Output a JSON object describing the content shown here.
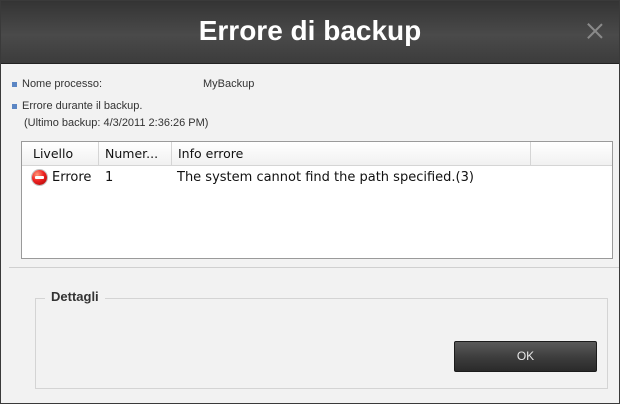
{
  "dialog": {
    "title": "Errore di backup",
    "process_label": "Nome processo:",
    "process_value": "MyBackup",
    "error_line1": "Errore durante il backup.",
    "error_line2": "(Ultimo backup: 4/3/2011 2:36:26 PM)"
  },
  "table": {
    "columns": [
      "Livello",
      "Numer...",
      "Info errore"
    ],
    "rows": [
      {
        "level": "Errore",
        "number": "1",
        "info": "The system cannot find the path specified.(3)",
        "icon": "error-icon"
      }
    ]
  },
  "details": {
    "legend": "Dettagli"
  },
  "buttons": {
    "ok": "OK"
  },
  "icons": {
    "close": "close-icon",
    "bullet": "bullet-icon",
    "error": "error-icon"
  },
  "colors": {
    "titlebar": "#3a3a3a",
    "title_text": "#ffffff",
    "bullet": "#5b86c4",
    "error_icon": "#e22222",
    "ok_button": "#3c3c3c"
  }
}
